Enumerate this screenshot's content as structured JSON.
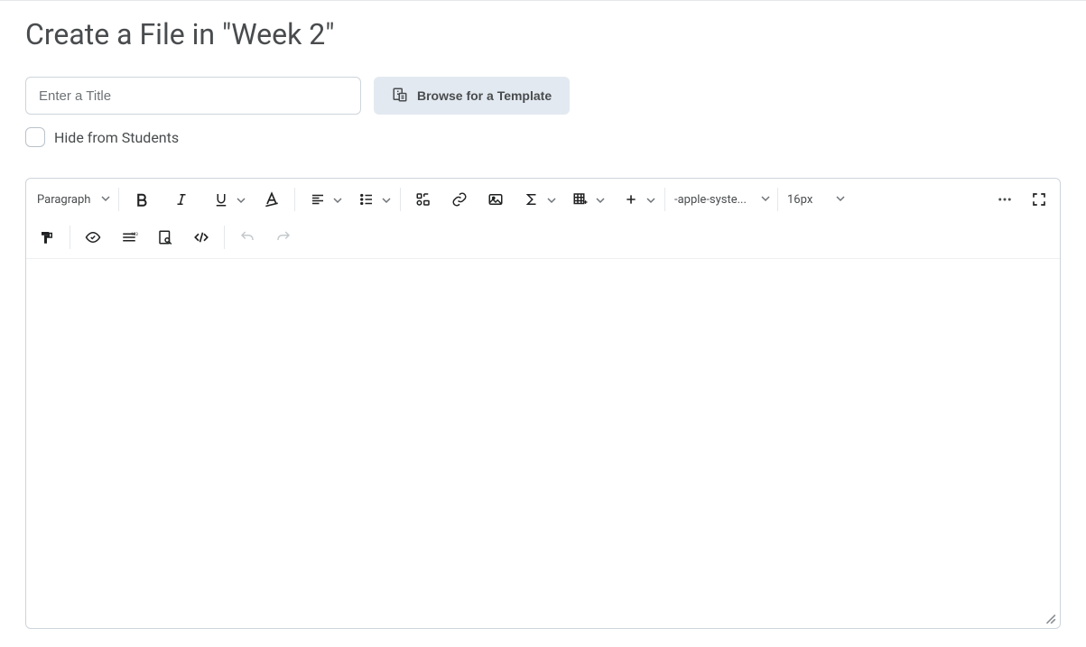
{
  "page": {
    "title": "Create a File in \"Week 2\""
  },
  "title_input": {
    "placeholder": "Enter a Title",
    "value": ""
  },
  "template_button": {
    "label": "Browse for a Template"
  },
  "hide_checkbox": {
    "label": "Hide from Students",
    "checked": false
  },
  "toolbar": {
    "paragraph": {
      "label": "Paragraph"
    },
    "font_family": {
      "value": "-apple-syste..."
    },
    "font_size": {
      "value": "16px"
    }
  },
  "icons": {
    "bold": "bold-icon",
    "italic": "italic-icon",
    "underline": "underline-icon",
    "strike_format": "format-A-icon",
    "align": "align-left-icon",
    "list": "list-icon",
    "insert_stuff": "insert-stuff-icon",
    "link": "link-icon",
    "image": "image-icon",
    "sigma": "sigma-icon",
    "table": "table-icon",
    "plus": "plus-icon",
    "more": "more-icon",
    "fullscreen": "fullscreen-icon",
    "paint": "format-painter-icon",
    "accessibility": "accessibility-check-icon",
    "word_count": "line-item-icon",
    "preview": "preview-icon",
    "source": "source-code-icon",
    "undo": "undo-icon",
    "redo": "redo-icon"
  }
}
